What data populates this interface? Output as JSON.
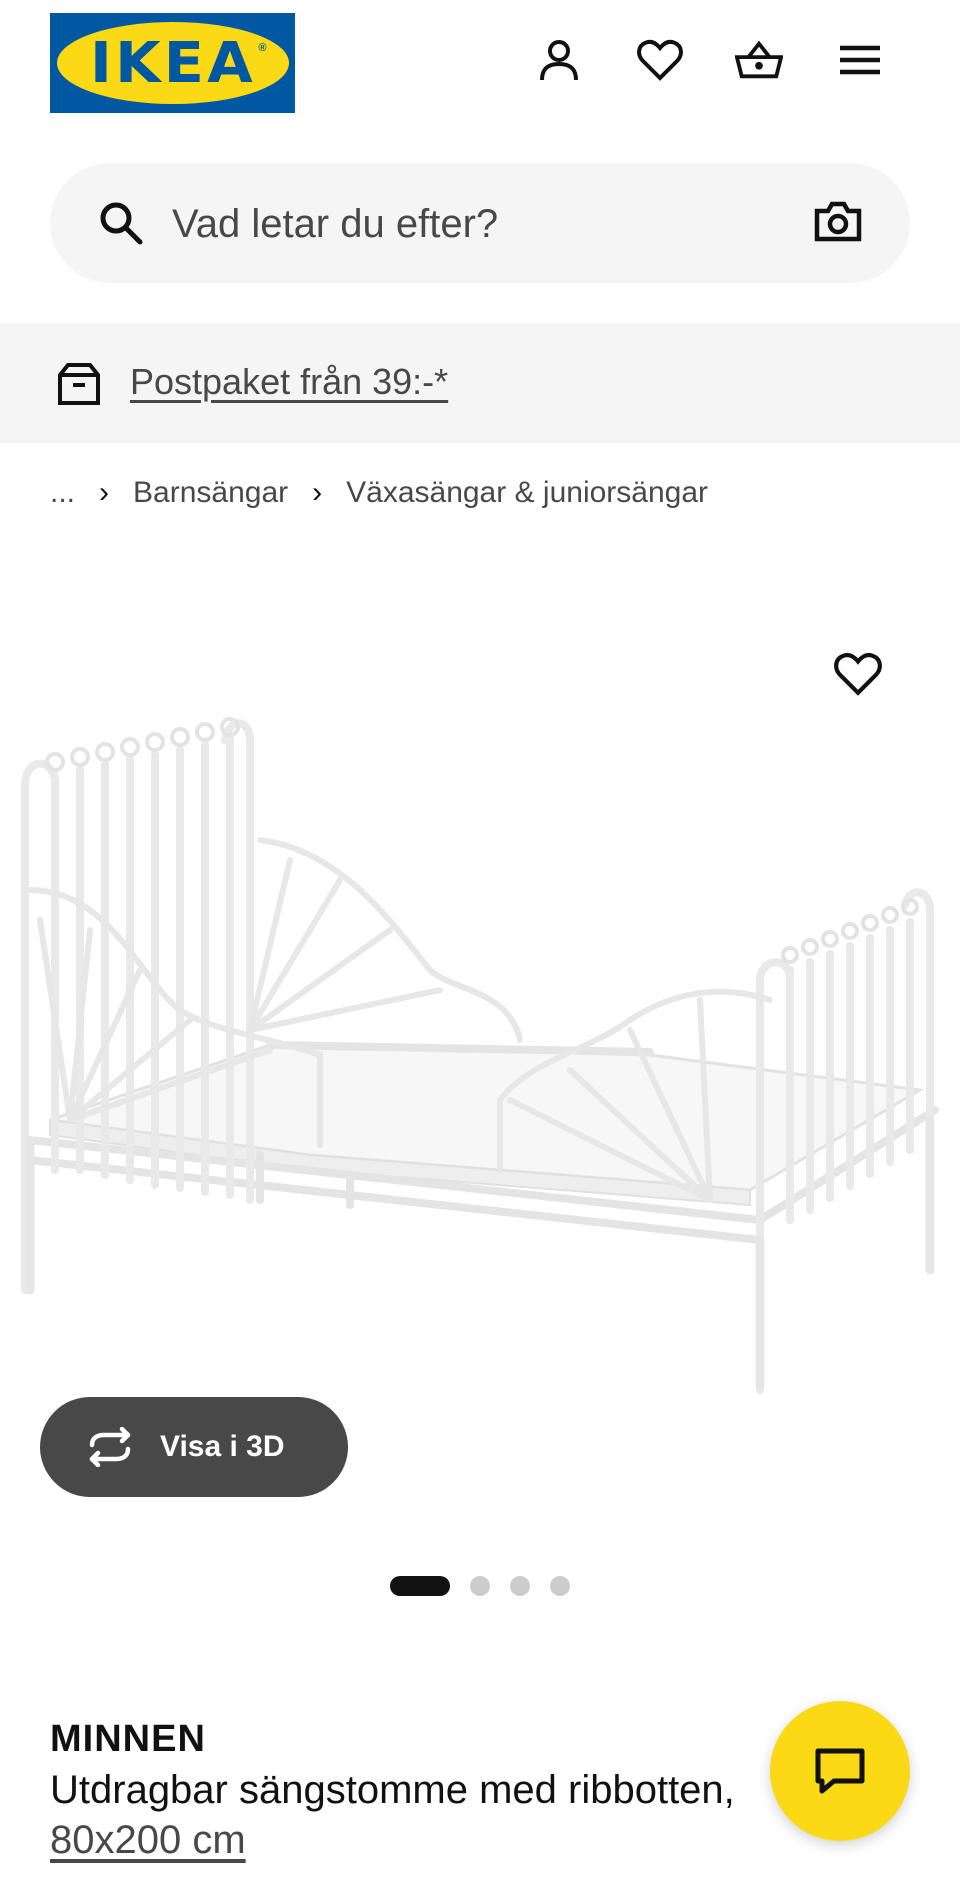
{
  "header": {
    "logo_text": "IKEA",
    "logo_reg": "®",
    "icons": [
      "account-icon",
      "heart-icon",
      "basket-icon",
      "menu-icon"
    ]
  },
  "search": {
    "placeholder": "Vad letar du efter?"
  },
  "banner": {
    "link_text": "Postpaket från 39:-*"
  },
  "breadcrumb": {
    "ellipsis": "...",
    "items": [
      "Barnsängar",
      "Växasängar & juniorsängar"
    ]
  },
  "gallery": {
    "view_3d_label": "Visa i 3D",
    "image_count": 4,
    "active_index": 0
  },
  "product": {
    "name": "MINNEN",
    "description": "Utdragbar sängstomme med ribbotten,",
    "size": "80x200 cm"
  },
  "colors": {
    "ikea_blue": "#0058a3",
    "ikea_yellow": "#fbd914",
    "text_dark": "#111111",
    "text_gray": "#484848",
    "surface_gray": "#f5f5f5"
  }
}
